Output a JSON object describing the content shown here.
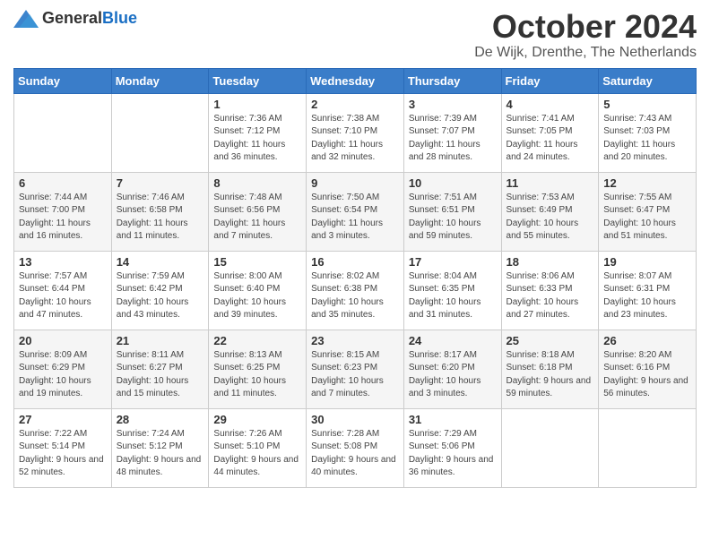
{
  "header": {
    "logo_general": "General",
    "logo_blue": "Blue",
    "month_title": "October 2024",
    "location": "De Wijk, Drenthe, The Netherlands"
  },
  "days_of_week": [
    "Sunday",
    "Monday",
    "Tuesday",
    "Wednesday",
    "Thursday",
    "Friday",
    "Saturday"
  ],
  "weeks": [
    [
      {
        "day": "",
        "sunrise": "",
        "sunset": "",
        "daylight": ""
      },
      {
        "day": "",
        "sunrise": "",
        "sunset": "",
        "daylight": ""
      },
      {
        "day": "1",
        "sunrise": "Sunrise: 7:36 AM",
        "sunset": "Sunset: 7:12 PM",
        "daylight": "Daylight: 11 hours and 36 minutes."
      },
      {
        "day": "2",
        "sunrise": "Sunrise: 7:38 AM",
        "sunset": "Sunset: 7:10 PM",
        "daylight": "Daylight: 11 hours and 32 minutes."
      },
      {
        "day": "3",
        "sunrise": "Sunrise: 7:39 AM",
        "sunset": "Sunset: 7:07 PM",
        "daylight": "Daylight: 11 hours and 28 minutes."
      },
      {
        "day": "4",
        "sunrise": "Sunrise: 7:41 AM",
        "sunset": "Sunset: 7:05 PM",
        "daylight": "Daylight: 11 hours and 24 minutes."
      },
      {
        "day": "5",
        "sunrise": "Sunrise: 7:43 AM",
        "sunset": "Sunset: 7:03 PM",
        "daylight": "Daylight: 11 hours and 20 minutes."
      }
    ],
    [
      {
        "day": "6",
        "sunrise": "Sunrise: 7:44 AM",
        "sunset": "Sunset: 7:00 PM",
        "daylight": "Daylight: 11 hours and 16 minutes."
      },
      {
        "day": "7",
        "sunrise": "Sunrise: 7:46 AM",
        "sunset": "Sunset: 6:58 PM",
        "daylight": "Daylight: 11 hours and 11 minutes."
      },
      {
        "day": "8",
        "sunrise": "Sunrise: 7:48 AM",
        "sunset": "Sunset: 6:56 PM",
        "daylight": "Daylight: 11 hours and 7 minutes."
      },
      {
        "day": "9",
        "sunrise": "Sunrise: 7:50 AM",
        "sunset": "Sunset: 6:54 PM",
        "daylight": "Daylight: 11 hours and 3 minutes."
      },
      {
        "day": "10",
        "sunrise": "Sunrise: 7:51 AM",
        "sunset": "Sunset: 6:51 PM",
        "daylight": "Daylight: 10 hours and 59 minutes."
      },
      {
        "day": "11",
        "sunrise": "Sunrise: 7:53 AM",
        "sunset": "Sunset: 6:49 PM",
        "daylight": "Daylight: 10 hours and 55 minutes."
      },
      {
        "day": "12",
        "sunrise": "Sunrise: 7:55 AM",
        "sunset": "Sunset: 6:47 PM",
        "daylight": "Daylight: 10 hours and 51 minutes."
      }
    ],
    [
      {
        "day": "13",
        "sunrise": "Sunrise: 7:57 AM",
        "sunset": "Sunset: 6:44 PM",
        "daylight": "Daylight: 10 hours and 47 minutes."
      },
      {
        "day": "14",
        "sunrise": "Sunrise: 7:59 AM",
        "sunset": "Sunset: 6:42 PM",
        "daylight": "Daylight: 10 hours and 43 minutes."
      },
      {
        "day": "15",
        "sunrise": "Sunrise: 8:00 AM",
        "sunset": "Sunset: 6:40 PM",
        "daylight": "Daylight: 10 hours and 39 minutes."
      },
      {
        "day": "16",
        "sunrise": "Sunrise: 8:02 AM",
        "sunset": "Sunset: 6:38 PM",
        "daylight": "Daylight: 10 hours and 35 minutes."
      },
      {
        "day": "17",
        "sunrise": "Sunrise: 8:04 AM",
        "sunset": "Sunset: 6:35 PM",
        "daylight": "Daylight: 10 hours and 31 minutes."
      },
      {
        "day": "18",
        "sunrise": "Sunrise: 8:06 AM",
        "sunset": "Sunset: 6:33 PM",
        "daylight": "Daylight: 10 hours and 27 minutes."
      },
      {
        "day": "19",
        "sunrise": "Sunrise: 8:07 AM",
        "sunset": "Sunset: 6:31 PM",
        "daylight": "Daylight: 10 hours and 23 minutes."
      }
    ],
    [
      {
        "day": "20",
        "sunrise": "Sunrise: 8:09 AM",
        "sunset": "Sunset: 6:29 PM",
        "daylight": "Daylight: 10 hours and 19 minutes."
      },
      {
        "day": "21",
        "sunrise": "Sunrise: 8:11 AM",
        "sunset": "Sunset: 6:27 PM",
        "daylight": "Daylight: 10 hours and 15 minutes."
      },
      {
        "day": "22",
        "sunrise": "Sunrise: 8:13 AM",
        "sunset": "Sunset: 6:25 PM",
        "daylight": "Daylight: 10 hours and 11 minutes."
      },
      {
        "day": "23",
        "sunrise": "Sunrise: 8:15 AM",
        "sunset": "Sunset: 6:23 PM",
        "daylight": "Daylight: 10 hours and 7 minutes."
      },
      {
        "day": "24",
        "sunrise": "Sunrise: 8:17 AM",
        "sunset": "Sunset: 6:20 PM",
        "daylight": "Daylight: 10 hours and 3 minutes."
      },
      {
        "day": "25",
        "sunrise": "Sunrise: 8:18 AM",
        "sunset": "Sunset: 6:18 PM",
        "daylight": "Daylight: 9 hours and 59 minutes."
      },
      {
        "day": "26",
        "sunrise": "Sunrise: 8:20 AM",
        "sunset": "Sunset: 6:16 PM",
        "daylight": "Daylight: 9 hours and 56 minutes."
      }
    ],
    [
      {
        "day": "27",
        "sunrise": "Sunrise: 7:22 AM",
        "sunset": "Sunset: 5:14 PM",
        "daylight": "Daylight: 9 hours and 52 minutes."
      },
      {
        "day": "28",
        "sunrise": "Sunrise: 7:24 AM",
        "sunset": "Sunset: 5:12 PM",
        "daylight": "Daylight: 9 hours and 48 minutes."
      },
      {
        "day": "29",
        "sunrise": "Sunrise: 7:26 AM",
        "sunset": "Sunset: 5:10 PM",
        "daylight": "Daylight: 9 hours and 44 minutes."
      },
      {
        "day": "30",
        "sunrise": "Sunrise: 7:28 AM",
        "sunset": "Sunset: 5:08 PM",
        "daylight": "Daylight: 9 hours and 40 minutes."
      },
      {
        "day": "31",
        "sunrise": "Sunrise: 7:29 AM",
        "sunset": "Sunset: 5:06 PM",
        "daylight": "Daylight: 9 hours and 36 minutes."
      },
      {
        "day": "",
        "sunrise": "",
        "sunset": "",
        "daylight": ""
      },
      {
        "day": "",
        "sunrise": "",
        "sunset": "",
        "daylight": ""
      }
    ]
  ]
}
